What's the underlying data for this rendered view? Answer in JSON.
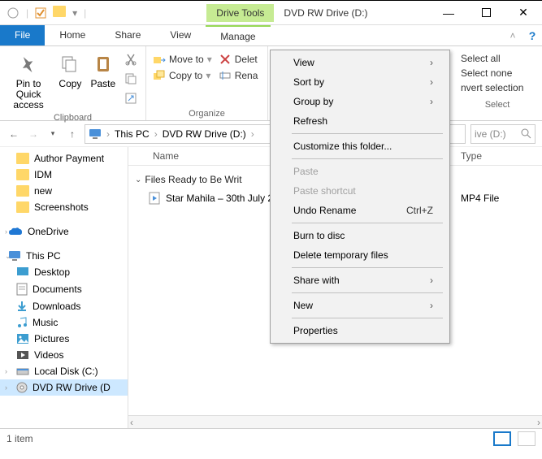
{
  "titlebar": {
    "drive_tools": "Drive Tools",
    "title": "DVD RW Drive (D:)"
  },
  "tabs": {
    "file": "File",
    "home": "Home",
    "share": "Share",
    "view": "View",
    "manage": "Manage"
  },
  "ribbon": {
    "pin": "Pin to Quick access",
    "copy": "Copy",
    "paste": "Paste",
    "clipboard": "Clipboard",
    "moveto": "Move to",
    "copyto": "Copy to",
    "delete": "Delet",
    "rename": "Rena",
    "organize": "Organize",
    "selectall": "Select all",
    "selectnone": "Select none",
    "invertsel": "nvert selection",
    "select": "Select"
  },
  "breadcrumb": {
    "thispc": "This PC",
    "drive": "DVD RW Drive (D:)"
  },
  "search": {
    "placeholder": "ive (D:)"
  },
  "columns": {
    "name": "Name",
    "type": "Type"
  },
  "group_header": "Files Ready to Be Writ",
  "files": [
    {
      "name": "Star Mahila – 30th July 20",
      "type": "MP4 File"
    }
  ],
  "nav": {
    "author_payment": "Author Payment",
    "idm": "IDM",
    "new": "new",
    "screenshots": "Screenshots",
    "onedrive": "OneDrive",
    "thispc": "This PC",
    "desktop": "Desktop",
    "documents": "Documents",
    "downloads": "Downloads",
    "music": "Music",
    "pictures": "Pictures",
    "videos": "Videos",
    "localdisk": "Local Disk (C:)",
    "dvdrw": "DVD RW Drive (D"
  },
  "status": {
    "count": "1 item"
  },
  "context": {
    "view": "View",
    "sortby": "Sort by",
    "groupby": "Group by",
    "refresh": "Refresh",
    "customize": "Customize this folder...",
    "paste": "Paste",
    "paste_shortcut": "Paste shortcut",
    "undo_rename": "Undo Rename",
    "undo_shortcut": "Ctrl+Z",
    "burn": "Burn to disc",
    "delete_temp": "Delete temporary files",
    "sharewith": "Share with",
    "new": "New",
    "properties": "Properties"
  }
}
